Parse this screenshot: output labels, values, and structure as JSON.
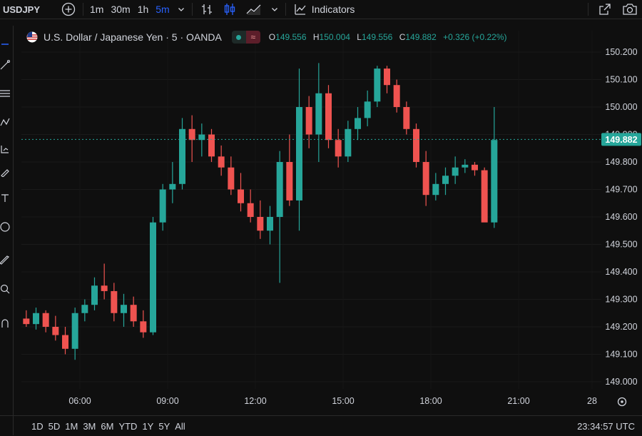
{
  "toolbar": {
    "symbol": "USDJPY",
    "timeframes": [
      "1m",
      "30m",
      "1h",
      "5m"
    ],
    "active_timeframe": "5m",
    "indicators_label": "Indicators"
  },
  "legend": {
    "title": "U.S. Dollar / Japanese Yen · 5 · OANDA",
    "o_label": "O",
    "o_value": "149.556",
    "h_label": "H",
    "h_value": "150.004",
    "l_label": "L",
    "l_value": "149.556",
    "c_label": "C",
    "c_value": "149.882",
    "change": "+0.326 (+0.22%)"
  },
  "colors": {
    "up": "#26a69a",
    "down": "#ef5350",
    "background": "#0f0f0f",
    "active_tab": "#2962ff",
    "price_tag": "#26a69a"
  },
  "chart_data": {
    "type": "candlestick",
    "price_axis_ticks": [
      "150.200",
      "150.100",
      "150.000",
      "149.900",
      "149.800",
      "149.700",
      "149.600",
      "149.500",
      "149.400",
      "149.300",
      "149.200",
      "149.100",
      "149.000"
    ],
    "time_axis_ticks": [
      "06:00",
      "09:00",
      "12:00",
      "15:00",
      "18:00",
      "21:00",
      "28"
    ],
    "ylim": [
      149.0,
      150.2
    ],
    "last_price": "149.882",
    "series": [
      {
        "time": "04:10",
        "o": 149.23,
        "h": 149.26,
        "l": 149.2,
        "c": 149.21
      },
      {
        "time": "04:30",
        "o": 149.21,
        "h": 149.27,
        "l": 149.19,
        "c": 149.25
      },
      {
        "time": "04:50",
        "o": 149.25,
        "h": 149.26,
        "l": 149.18,
        "c": 149.2
      },
      {
        "time": "05:10",
        "o": 149.2,
        "h": 149.24,
        "l": 149.15,
        "c": 149.17
      },
      {
        "time": "05:30",
        "o": 149.17,
        "h": 149.2,
        "l": 149.1,
        "c": 149.12
      },
      {
        "time": "05:50",
        "o": 149.12,
        "h": 149.27,
        "l": 149.08,
        "c": 149.25
      },
      {
        "time": "06:10",
        "o": 149.25,
        "h": 149.3,
        "l": 149.22,
        "c": 149.28
      },
      {
        "time": "06:30",
        "o": 149.28,
        "h": 149.38,
        "l": 149.26,
        "c": 149.35
      },
      {
        "time": "06:50",
        "o": 149.35,
        "h": 149.43,
        "l": 149.3,
        "c": 149.33
      },
      {
        "time": "07:10",
        "o": 149.33,
        "h": 149.36,
        "l": 149.22,
        "c": 149.25
      },
      {
        "time": "07:30",
        "o": 149.25,
        "h": 149.32,
        "l": 149.2,
        "c": 149.28
      },
      {
        "time": "07:50",
        "o": 149.28,
        "h": 149.31,
        "l": 149.2,
        "c": 149.22
      },
      {
        "time": "08:10",
        "o": 149.22,
        "h": 149.26,
        "l": 149.16,
        "c": 149.18
      },
      {
        "time": "08:30",
        "o": 149.18,
        "h": 149.6,
        "l": 149.17,
        "c": 149.58
      },
      {
        "time": "08:50",
        "o": 149.58,
        "h": 149.72,
        "l": 149.55,
        "c": 149.7
      },
      {
        "time": "09:10",
        "o": 149.7,
        "h": 149.8,
        "l": 149.65,
        "c": 149.72
      },
      {
        "time": "09:30",
        "o": 149.72,
        "h": 149.96,
        "l": 149.7,
        "c": 149.92
      },
      {
        "time": "09:50",
        "o": 149.92,
        "h": 149.97,
        "l": 149.8,
        "c": 149.88
      },
      {
        "time": "10:10",
        "o": 149.88,
        "h": 149.94,
        "l": 149.82,
        "c": 149.9
      },
      {
        "time": "10:30",
        "o": 149.9,
        "h": 149.92,
        "l": 149.8,
        "c": 149.82
      },
      {
        "time": "10:50",
        "o": 149.82,
        "h": 149.86,
        "l": 149.75,
        "c": 149.78
      },
      {
        "time": "11:10",
        "o": 149.78,
        "h": 149.82,
        "l": 149.68,
        "c": 149.7
      },
      {
        "time": "11:30",
        "o": 149.7,
        "h": 149.76,
        "l": 149.62,
        "c": 149.65
      },
      {
        "time": "11:50",
        "o": 149.65,
        "h": 149.7,
        "l": 149.58,
        "c": 149.6
      },
      {
        "time": "12:10",
        "o": 149.6,
        "h": 149.66,
        "l": 149.52,
        "c": 149.55
      },
      {
        "time": "12:30",
        "o": 149.55,
        "h": 149.64,
        "l": 149.5,
        "c": 149.6
      },
      {
        "time": "12:50",
        "o": 149.6,
        "h": 149.84,
        "l": 149.36,
        "c": 149.8
      },
      {
        "time": "13:10",
        "o": 149.8,
        "h": 149.9,
        "l": 149.64,
        "c": 149.66
      },
      {
        "time": "13:30",
        "o": 149.66,
        "h": 150.14,
        "l": 149.55,
        "c": 150.0
      },
      {
        "time": "13:50",
        "o": 150.0,
        "h": 150.04,
        "l": 149.85,
        "c": 149.9
      },
      {
        "time": "14:10",
        "o": 149.9,
        "h": 150.16,
        "l": 149.8,
        "c": 150.05
      },
      {
        "time": "14:30",
        "o": 150.05,
        "h": 150.08,
        "l": 149.85,
        "c": 149.88
      },
      {
        "time": "14:50",
        "o": 149.88,
        "h": 149.92,
        "l": 149.78,
        "c": 149.82
      },
      {
        "time": "15:10",
        "o": 149.82,
        "h": 149.95,
        "l": 149.8,
        "c": 149.92
      },
      {
        "time": "15:30",
        "o": 149.92,
        "h": 150.0,
        "l": 149.88,
        "c": 149.96
      },
      {
        "time": "15:50",
        "o": 149.96,
        "h": 150.06,
        "l": 149.93,
        "c": 150.02
      },
      {
        "time": "16:10",
        "o": 150.02,
        "h": 150.15,
        "l": 150.0,
        "c": 150.14
      },
      {
        "time": "16:30",
        "o": 150.14,
        "h": 150.15,
        "l": 150.05,
        "c": 150.08
      },
      {
        "time": "16:50",
        "o": 150.08,
        "h": 150.1,
        "l": 149.98,
        "c": 150.0
      },
      {
        "time": "17:10",
        "o": 150.0,
        "h": 150.02,
        "l": 149.9,
        "c": 149.92
      },
      {
        "time": "17:30",
        "o": 149.92,
        "h": 149.94,
        "l": 149.78,
        "c": 149.8
      },
      {
        "time": "17:50",
        "o": 149.8,
        "h": 149.84,
        "l": 149.64,
        "c": 149.68
      },
      {
        "time": "18:10",
        "o": 149.68,
        "h": 149.76,
        "l": 149.66,
        "c": 149.72
      },
      {
        "time": "18:30",
        "o": 149.72,
        "h": 149.78,
        "l": 149.68,
        "c": 149.75
      },
      {
        "time": "18:50",
        "o": 149.75,
        "h": 149.82,
        "l": 149.72,
        "c": 149.78
      },
      {
        "time": "19:10",
        "o": 149.78,
        "h": 149.81,
        "l": 149.76,
        "c": 149.79
      },
      {
        "time": "19:30",
        "o": 149.79,
        "h": 149.8,
        "l": 149.75,
        "c": 149.77
      },
      {
        "time": "19:50",
        "o": 149.77,
        "h": 149.78,
        "l": 149.6,
        "c": 149.58
      },
      {
        "time": "20:10",
        "o": 149.58,
        "h": 150.0,
        "l": 149.56,
        "c": 149.88
      }
    ]
  },
  "bottom": {
    "ranges": [
      "1D",
      "5D",
      "1M",
      "3M",
      "6M",
      "YTD",
      "1Y",
      "5Y",
      "All"
    ],
    "clock": "23:34:57 UTC"
  }
}
